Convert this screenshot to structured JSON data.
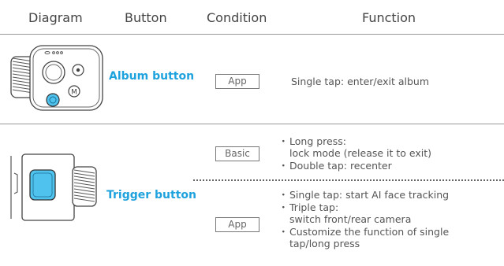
{
  "headers": {
    "diagram": "Diagram",
    "button": "Button",
    "condition": "Condition",
    "function": "Function"
  },
  "rows": [
    {
      "button": "Album button",
      "condition": "App",
      "function": "Single tap: enter/exit album"
    },
    {
      "button": "Trigger button",
      "conditions": [
        {
          "label": "Basic",
          "items": [
            {
              "lines": [
                "Long press:",
                "lock mode (release it to exit)"
              ]
            },
            {
              "lines": [
                "Double tap: recenter"
              ]
            }
          ]
        },
        {
          "label": "App",
          "items": [
            {
              "lines": [
                "Single tap: start AI face tracking"
              ]
            },
            {
              "lines": [
                "Triple tap:",
                "switch front/rear camera"
              ]
            },
            {
              "lines": [
                "Customize the function of single",
                "tap/long press"
              ]
            }
          ]
        }
      ]
    }
  ],
  "colors": {
    "accent": "#1ea2dd",
    "highlight_fill": "#4fc2ee"
  },
  "bullet": "・"
}
